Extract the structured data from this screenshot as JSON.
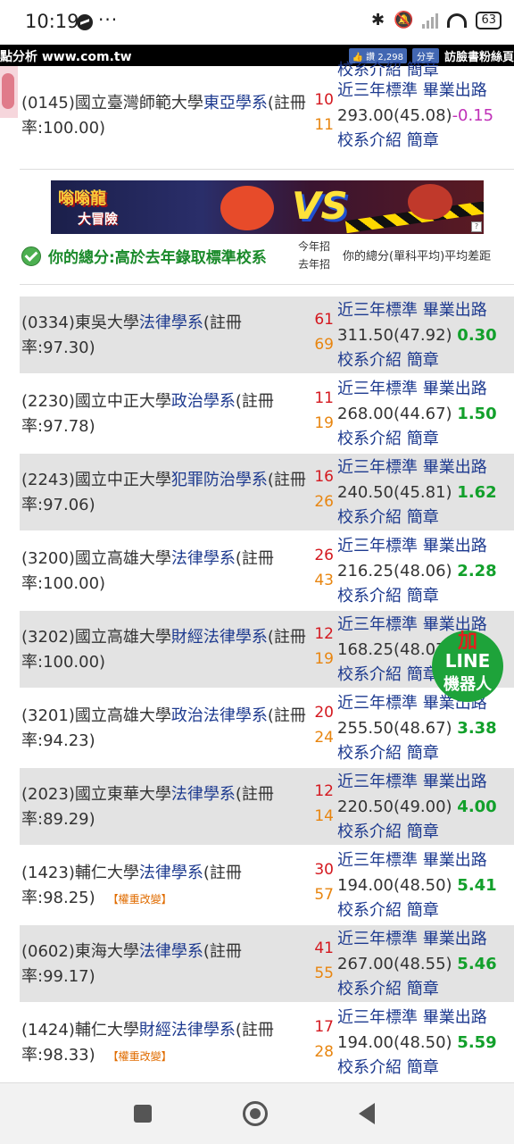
{
  "status_bar": {
    "time": "10:19",
    "dots": "···",
    "battery": "63"
  },
  "site_header": {
    "left_text": "點分析 www.com.tw",
    "like_label": "👍 讚 2,298",
    "share_label": "分享",
    "fans_label": "訪臉書粉絲頁"
  },
  "partial_top_link": "校系介紹 簡章",
  "top_row": {
    "name_prefix": "(0145)國立臺灣師範大學",
    "dept": "東亞學系",
    "name_suffix": "(註冊率:100.00)",
    "this_year": "10",
    "last_year": "11",
    "standard_label": "近三年標準",
    "career_label": "畢業出路",
    "score": "293.00(45.08)",
    "diff": "-0.15",
    "intro_label": "校系介紹",
    "brochure_label": "簡章"
  },
  "ad": {
    "title": "嗡嗡龍",
    "subtitle": "大冒險",
    "vs": "VS"
  },
  "section": {
    "title": "你的總分:高於去年錄取標準校系",
    "col_this_year": "今年招",
    "col_last_year": "去年招",
    "col_diff": "你的總分(單科平均)平均差距"
  },
  "rows": [
    {
      "prefix": "(0334)東吳大學",
      "dept": "法律學系",
      "suffix": "(註冊率:97.30)",
      "q1": "61",
      "q2": "69",
      "score": "311.50(47.92)",
      "diff": "0.30",
      "tag": ""
    },
    {
      "prefix": "(2230)國立中正大學",
      "dept": "政治學系",
      "suffix": "(註冊率:97.78)",
      "q1": "11",
      "q2": "19",
      "score": "268.00(44.67)",
      "diff": "1.50",
      "tag": ""
    },
    {
      "prefix": "(2243)國立中正大學",
      "dept": "犯罪防治學系",
      "suffix": "(註冊率:97.06)",
      "q1": "16",
      "q2": "26",
      "score": "240.50(45.81)",
      "diff": "1.62",
      "tag": ""
    },
    {
      "prefix": "(3200)國立高雄大學",
      "dept": "法律學系",
      "suffix": "(註冊率:100.00)",
      "q1": "26",
      "q2": "43",
      "score": "216.25(48.06)",
      "diff": "2.28",
      "tag": ""
    },
    {
      "prefix": "(3202)國立高雄大學",
      "dept": "財經法律學系",
      "suffix": "(註冊率:100.00)",
      "q1": "12",
      "q2": "19",
      "score": "168.25(48.07)",
      "diff": "",
      "tag": ""
    },
    {
      "prefix": "(3201)國立高雄大學",
      "dept": "政治法律學系",
      "suffix": "(註冊率:94.23)",
      "q1": "20",
      "q2": "24",
      "score": "255.50(48.67)",
      "diff": "3.38",
      "tag": ""
    },
    {
      "prefix": "(2023)國立東華大學",
      "dept": "法律學系",
      "suffix": "(註冊率:89.29)",
      "q1": "12",
      "q2": "14",
      "score": "220.50(49.00)",
      "diff": "4.00",
      "tag": ""
    },
    {
      "prefix": "(1423)輔仁大學",
      "dept": "法律學系",
      "suffix": "(註冊率:98.25)",
      "q1": "30",
      "q2": "57",
      "score": "194.00(48.50)",
      "diff": "5.41",
      "tag": "【權重改變】"
    },
    {
      "prefix": "(0602)東海大學",
      "dept": "法律學系",
      "suffix": "(註冊率:99.17)",
      "q1": "41",
      "q2": "55",
      "score": "267.00(48.55)",
      "diff": "5.46",
      "tag": ""
    },
    {
      "prefix": "(1424)輔仁大學",
      "dept": "財經法律學系",
      "suffix": "(註冊率:98.33)",
      "q1": "17",
      "q2": "28",
      "score": "194.00(48.50)",
      "diff": "5.59",
      "tag": "【權重改變】"
    }
  ],
  "row_labels": {
    "standard": "近三年標準",
    "career": "畢業出路",
    "intro": "校系介紹",
    "brochure": "簡章"
  },
  "line_bot": {
    "plus": "加",
    "line": "LINE",
    "bot": "機器人"
  }
}
